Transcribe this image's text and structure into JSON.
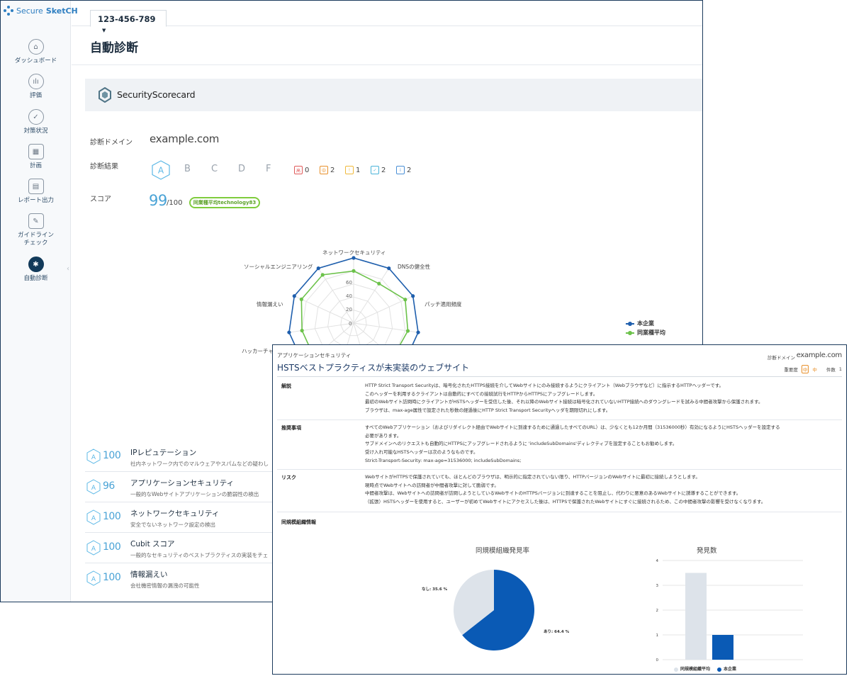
{
  "brand": {
    "prefix": "Secure",
    "name": "SketCH"
  },
  "sidebar": {
    "items": [
      {
        "label": "ダッシュボード",
        "icon": "home-icon"
      },
      {
        "label": "評価",
        "icon": "bar-chart-icon"
      },
      {
        "label": "対策状況",
        "icon": "check-circle-icon"
      },
      {
        "label": "計画",
        "icon": "calendar-icon"
      },
      {
        "label": "レポート出力",
        "icon": "report-icon"
      },
      {
        "label_line1": "ガイドライン",
        "label_line2": "チェック",
        "icon": "guideline-icon"
      },
      {
        "label": "自動診断",
        "icon": "auto-diagnosis-icon",
        "active": true
      }
    ]
  },
  "account": {
    "number": "123-456-789",
    "caret": "▼"
  },
  "page": {
    "title": "自動診断"
  },
  "banner": {
    "vendor": "SecurityScorecard"
  },
  "summary": {
    "domain_label": "診断ドメイン",
    "domain": "example.com",
    "result_label": "診断結果",
    "grades": [
      "A",
      "B",
      "C",
      "D",
      "F"
    ],
    "active_grade": "A",
    "severity": [
      {
        "mark": "高",
        "count": "0",
        "color": "#e05a5a"
      },
      {
        "mark": "中",
        "count": "2",
        "color": "#e8902a"
      },
      {
        "mark": "!",
        "count": "1",
        "color": "#f0b93a"
      },
      {
        "mark": "✓",
        "count": "2",
        "color": "#49b3d8"
      },
      {
        "mark": "i",
        "count": "2",
        "color": "#4a8fd6"
      }
    ],
    "score_label": "スコア",
    "score": "99",
    "score_max": "/100",
    "industry_badge": "同業種平均technology83"
  },
  "radar_chart": {
    "labels": [
      "ネットワークセキュリティ",
      "DNSの健全性",
      "パッチ適用頻度",
      "ハッカーチャ",
      "情報漏えい",
      "ソーシャルエンジニアリング"
    ],
    "ticks": [
      "0",
      "20",
      "40",
      "60"
    ],
    "legend": [
      {
        "name": "本企業",
        "color": "#1f5fad"
      },
      {
        "name": "同業種平均",
        "color": "#6cc24a"
      }
    ]
  },
  "chart_data": [
    {
      "type": "radar",
      "axes": [
        "ネットワークセキュリティ",
        "DNSの健全性",
        "パッチ適用頻度",
        "ハッカーチャ",
        "",
        "",
        "",
        "",
        "",
        "情報漏えい",
        "ソーシャルエンジニアリング"
      ],
      "rmax": 100,
      "ticks": [
        0,
        20,
        40,
        60
      ],
      "series": [
        {
          "name": "本企業",
          "values": [
            100,
            100,
            100,
            100,
            100,
            100,
            100,
            100,
            100,
            100,
            100
          ]
        },
        {
          "name": "同業種平均",
          "values": [
            80,
            72,
            87,
            84,
            80,
            80,
            80,
            80,
            80,
            88,
            88
          ]
        }
      ]
    },
    {
      "type": "pie",
      "title": "同規模組織発見率",
      "slices": [
        {
          "label": "あり",
          "value": 64.4,
          "color": "#0a5ab5"
        },
        {
          "label": "なし",
          "value": 35.6,
          "color": "#dde3ea"
        }
      ]
    },
    {
      "type": "bar",
      "title": "発見数",
      "categories": [
        "同規模組織平均",
        "本企業"
      ],
      "values": [
        3.5,
        1
      ],
      "ylim": [
        0,
        4
      ],
      "yticks": [
        0,
        1,
        2,
        3,
        4
      ],
      "colors": [
        "#dde3ea",
        "#0a5ab5"
      ]
    }
  ],
  "categories": [
    {
      "grade": "A",
      "score": "100",
      "title": "IPレピュテーション",
      "desc": "社内ネットワーク内でのマルウェアやスパムなどの疑わし"
    },
    {
      "grade": "A",
      "score": "96",
      "title": "アプリケーションセキュリティ",
      "desc": "一般的なWebサイトアプリケーションの脆弱性の検出"
    },
    {
      "grade": "A",
      "score": "100",
      "title": "ネットワークセキュリティ",
      "desc": "安全でないネットワーク設定の検出"
    },
    {
      "grade": "A",
      "score": "100",
      "title": "Cubit スコア",
      "desc": "一般的なセキュリティのベストプラクティスの実装をチェ"
    },
    {
      "grade": "A",
      "score": "100",
      "title": "情報漏えい",
      "desc": "会社機密情報の漏洩の可能性"
    }
  ],
  "modal": {
    "category": "アプリケーションセキュリティ",
    "title": "HSTSベストプラクティスが未実装のウェブサイト",
    "domain_label": "診断ドメイン",
    "domain": "example.com",
    "severity_label": "重要度",
    "severity_mark": "中",
    "severity_value": "中",
    "count_label": "件数",
    "count": "1",
    "sections": [
      {
        "label": "解説",
        "lines": [
          "HTTP Strict Transport Securityは、暗号化されたHTTPS接続を介してWebサイトにのみ接続するようにクライアント（Webブラウザなど）に指示するHTTPヘッダーです。",
          "このヘッダーを利用するクライアントは自動的にすべての接続試行をHTTPからHTTPSにアップグレードします。",
          "最初のWebサイト訪問時にクライアントがHSTSヘッダーを受信した後、それ以降のWebサイト接続は暗号化されていないHTTP接続へのダウングレードを試みる中間者攻撃から保護されます。",
          "ブラウザは、max-age属性で設定された秒数の経過後にHTTP Strict Transport Securityヘッダを期限切れにします。"
        ]
      },
      {
        "label": "推奨事項",
        "lines": [
          "すべてのWebアプリケーション（およびリダイレクト経由でWebサイトに到達するために通過したすべてのURL）は、少なくとも12か月間（31536000秒）有効になるようにHSTSヘッダーを設定する",
          "必要があります。",
          "サブドメインへのリクエストも自動的にHTTPSにアップグレードされるように 'includeSubDomains'ディレクティブを設定することもお勧めします。",
          "受け入れ可能なHSTSヘッダーは次のようなものです。",
          "Strict-Transport-Security: max-age=31536000; includeSubDomains;"
        ]
      },
      {
        "label": "リスク",
        "lines": [
          "WebサイトがHTTPSで保護されていても、ほとんどのブラウザは、明示的に指定されていない限り、HTTPバージョンのWebサイトに最初に接続しようとします。",
          "現時点でWebサイトへの訪問者が中間者攻撃に対して脆弱です。",
          "中間者攻撃は、Webサイトへの訪問者が訪問しようとしているWebサイトのHTTPSバージョンに到達することを阻止し、代わりに悪意のあるWebサイトに誘導することができます。",
          "（拡張）HSTSヘッダーを使用すると、ユーザーが初めてWebサイトにアクセスした後は、HTTPSで保護されたWebサイトにすぐに接続されるため、この中間者攻撃の影響を受けなくなります。"
        ]
      }
    ],
    "peer_label": "同規模組織情報",
    "pie_title": "同規模組織発見率",
    "pie_labels": {
      "yes": "あり: 64.4 %",
      "no": "なし: 35.6 %"
    },
    "bar_title": "発見数",
    "bar_legend": [
      "同規模組織平均",
      "本企業"
    ],
    "bar_ticks": [
      "0",
      "1",
      "2",
      "3",
      "4"
    ]
  }
}
